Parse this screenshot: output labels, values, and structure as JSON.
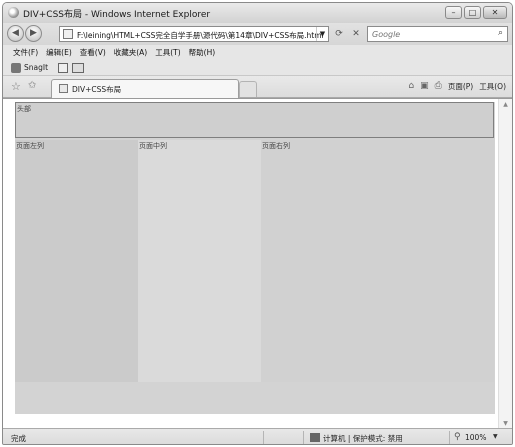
{
  "window": {
    "title": "DIV+CSS布局 - Windows Internet Explorer",
    "controls": {
      "minimize": "–",
      "maximize": "□",
      "close": "✕"
    }
  },
  "address_bar": {
    "back": "◀",
    "forward": "▶",
    "url": "F:\\leining\\HTML+CSS完全自学手册\\源代码\\第14章\\DIV+CSS布局.html",
    "dropdown": "▼",
    "refresh": "⟳",
    "stop": "✕"
  },
  "search": {
    "placeholder": "Google",
    "icon": "⌕"
  },
  "menu": [
    "文件(F)",
    "编辑(E)",
    "查看(V)",
    "收藏夹(A)",
    "工具(T)",
    "帮助(H)"
  ],
  "links_bar": {
    "snagit_label": "SnagIt"
  },
  "tab": {
    "label": "DIV+CSS布局"
  },
  "command_bar": {
    "home": "⌂",
    "feeds": "▣",
    "print": "⎙",
    "page_label": "页面(P)",
    "tools_label": "工具(O)",
    "dropdown": "▾"
  },
  "page": {
    "header_label": "头部",
    "left_label": "页面左列",
    "middle_label": "页面中列",
    "right_label": "页面右列"
  },
  "scrollbar": {
    "up": "▲",
    "down": "▼"
  },
  "status_bar": {
    "status": "完成",
    "zone": "计算机 | 保护模式: 禁用",
    "zoom": "100%",
    "zoom_icon": "⚲",
    "zoom_dropdown": "▼"
  }
}
